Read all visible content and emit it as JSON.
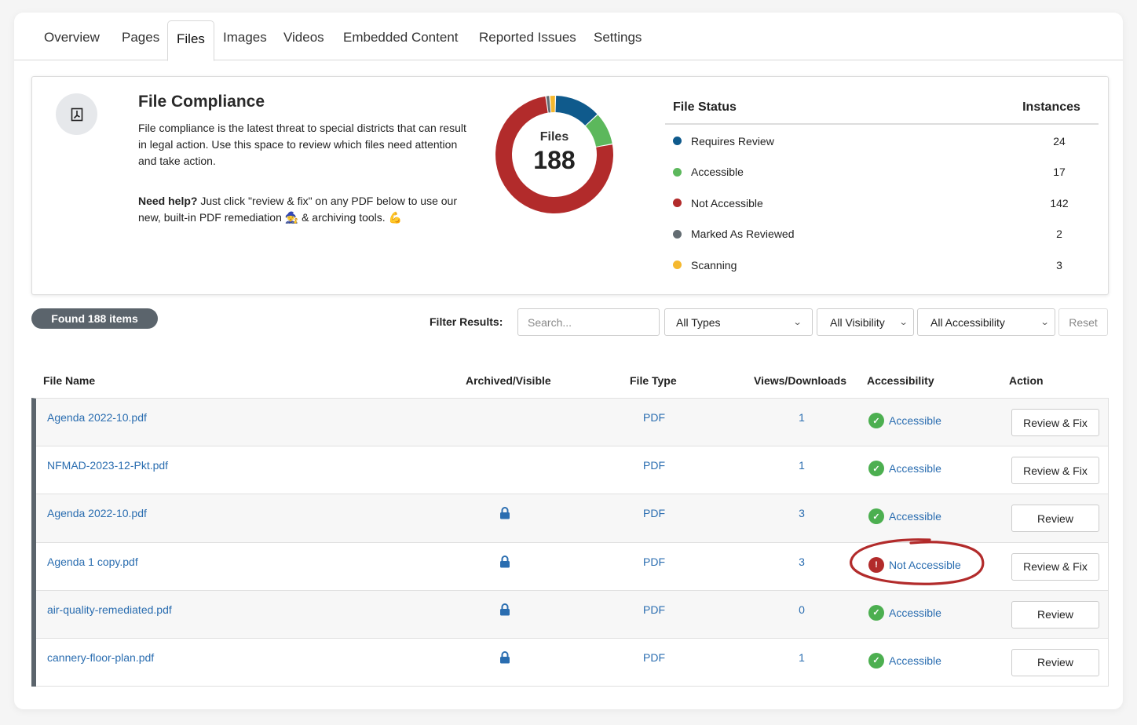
{
  "tabs": [
    {
      "label": "Overview",
      "active": false
    },
    {
      "label": "Pages",
      "active": false
    },
    {
      "label": "Files",
      "active": true
    },
    {
      "label": "Images",
      "active": false
    },
    {
      "label": "Videos",
      "active": false
    },
    {
      "label": "Embedded Content",
      "active": false
    },
    {
      "label": "Reported Issues",
      "active": false
    },
    {
      "label": "Settings",
      "active": false
    }
  ],
  "summary": {
    "icon": "pdf-file-icon",
    "title": "File Compliance",
    "description": "File compliance is the latest threat to special districts that can result in legal action. Use this space to review which files need attention and take action.",
    "help_bold": "Need help?",
    "help_text": " Just click \"review & fix\" on any PDF below to use our new, built-in PDF remediation 🧙 & archiving tools. 💪"
  },
  "chart_data": {
    "type": "pie",
    "title": "Files",
    "center_value": "188",
    "categories": [
      "Requires Review",
      "Accessible",
      "Not Accessible",
      "Marked As Reviewed",
      "Scanning"
    ],
    "values": [
      24,
      17,
      142,
      2,
      3
    ],
    "colors": [
      "#0f5a8c",
      "#5cb85c",
      "#b22b2b",
      "#636c72",
      "#f5b82e"
    ]
  },
  "status_table": {
    "header_status": "File Status",
    "header_instances": "Instances",
    "rows": [
      {
        "label": "Requires Review",
        "count": "24",
        "color": "#0f5a8c"
      },
      {
        "label": "Accessible",
        "count": "17",
        "color": "#5cb85c"
      },
      {
        "label": "Not Accessible",
        "count": "142",
        "color": "#b22b2b"
      },
      {
        "label": "Marked As Reviewed",
        "count": "2",
        "color": "#636c72"
      },
      {
        "label": "Scanning",
        "count": "3",
        "color": "#f5b82e"
      }
    ]
  },
  "filters": {
    "found_label": "Found 188 items",
    "filter_label": "Filter Results:",
    "search_placeholder": "Search...",
    "search_value": "",
    "type_select": "All Types",
    "visibility_select": "All Visibility",
    "accessibility_select": "All Accessibility",
    "reset_label": "Reset"
  },
  "table": {
    "columns": [
      "File Name",
      "Archived/Visible",
      "File Type",
      "Views/Downloads",
      "Accessibility",
      "Action"
    ],
    "rows": [
      {
        "name": "Agenda 2022-10.pdf",
        "archived": false,
        "type": "PDF",
        "views": "1",
        "status": "Accessible",
        "accessible": true,
        "action": "Review & Fix"
      },
      {
        "name": "NFMAD-2023-12-Pkt.pdf",
        "archived": false,
        "type": "PDF",
        "views": "1",
        "status": "Accessible",
        "accessible": true,
        "action": "Review & Fix"
      },
      {
        "name": "Agenda 2022-10.pdf",
        "archived": true,
        "type": "PDF",
        "views": "3",
        "status": "Accessible",
        "accessible": true,
        "action": "Review"
      },
      {
        "name": "Agenda 1 copy.pdf",
        "archived": true,
        "type": "PDF",
        "views": "3",
        "status": "Not Accessible",
        "accessible": false,
        "action": "Review & Fix"
      },
      {
        "name": "air-quality-remediated.pdf",
        "archived": true,
        "type": "PDF",
        "views": "0",
        "status": "Accessible",
        "accessible": true,
        "action": "Review"
      },
      {
        "name": "cannery-floor-plan.pdf",
        "archived": true,
        "type": "PDF",
        "views": "1",
        "status": "Accessible",
        "accessible": true,
        "action": "Review"
      }
    ]
  },
  "colors": {
    "link": "#2a6db0",
    "accessible": "#4caf50",
    "not_accessible": "#b22b2b",
    "annotation": "#b22b2b"
  }
}
